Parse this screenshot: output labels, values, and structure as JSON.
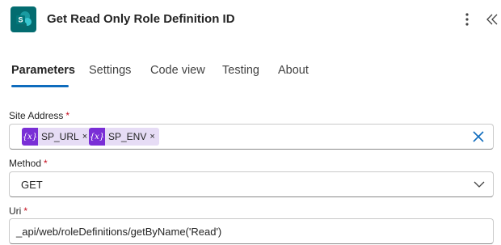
{
  "header": {
    "title": "Get Read Only Role Definition ID",
    "app_icon": "sharepoint-icon",
    "app_icon_color": "#036c70",
    "more_icon": "more-vertical-icon",
    "collapse_icon": "double-chevron-left-icon"
  },
  "tabs": [
    {
      "label": "Parameters",
      "active": true
    },
    {
      "label": "Settings",
      "active": false
    },
    {
      "label": "Code view",
      "active": false
    },
    {
      "label": "Testing",
      "active": false
    },
    {
      "label": "About",
      "active": false
    }
  ],
  "accent_color": "#0f6cbd",
  "fields": {
    "site_address": {
      "label": "Site Address",
      "required_mark": "*",
      "tokens": [
        {
          "icon_text": "{x}",
          "label": "SP_URL",
          "remove": "×"
        },
        {
          "icon_text": "{x}",
          "label": "SP_ENV",
          "remove": "×"
        }
      ],
      "token_color": "#7a2fd6",
      "clear_icon": "close-icon"
    },
    "method": {
      "label": "Method",
      "required_mark": "*",
      "value": "GET",
      "dropdown_icon": "chevron-down-icon"
    },
    "uri": {
      "label": "Uri",
      "required_mark": "*",
      "value": "_api/web/roleDefinitions/getByName('Read')"
    }
  }
}
